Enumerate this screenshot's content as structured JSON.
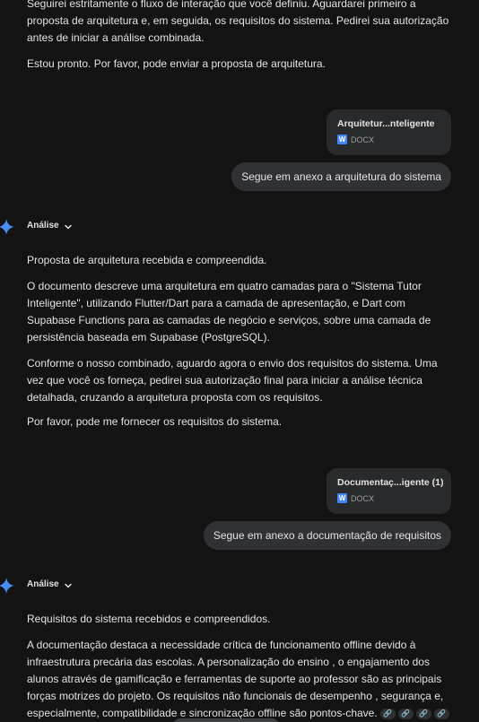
{
  "conversation": {
    "ai_intro": {
      "para1": "Seguirei estritamente o fluxo de interação que você definiu. Aguardarei primeiro a proposta de arquitetura e, em seguida, os requisitos do sistema. Pedirei sua autorização antes de iniciar a análise combinada.",
      "para2": "Estou pronto. Por favor, pode enviar a proposta de arquitetura."
    },
    "user_msg1": {
      "file_name": "Arquitetur...nteligente",
      "file_type": "DOCX",
      "text": "Segue em anexo a arquitetura do sistema"
    },
    "ai_reply1": {
      "label": "Análise",
      "para1": "Proposta de arquitetura recebida e compreendida.",
      "para2": "O documento descreve uma arquitetura em quatro camadas para o \"Sistema Tutor Inteligente\", utilizando Flutter/Dart para a camada de apresentação, e Dart com Supabase Functions para as camadas de negócio e serviços, sobre uma camada de persistência baseada em Supabase (PostgreSQL).",
      "para3": "Conforme o nosso combinado, aguardo agora o envio dos requisitos do sistema. Uma vez que você os forneça, pedirei sua autorização final para iniciar a análise técnica detalhada, cruzando a arquitetura proposta com os requisitos.",
      "para4": "Por favor, pode me fornecer os requisitos do sistema."
    },
    "user_msg2": {
      "file_name": "Documentaç...igente (1)",
      "file_type": "DOCX",
      "text": "Segue em anexo a documentação de requisitos"
    },
    "ai_reply2": {
      "label": "Análise",
      "para1": "Requisitos do sistema recebidos e compreendidos.",
      "para2": "A documentação destaca a necessidade crítica de funcionamento offline devido à infraestrutura precária das escolas. A personalização do ensino , o engajamento dos alunos através de gamificação e ferramentas de suporte ao professor  são as principais forças motrizes do projeto. Os requisitos não funcionais de desempenho , segurança e, especialmente, compatibilidade e sincronização offline  são pontos-chave."
    }
  },
  "icons": {
    "sparkle": "gemini-sparkle-icon",
    "chevron": "chevron-down-icon",
    "docx": "docx-icon",
    "link": "link-icon"
  },
  "colors": {
    "background": "#131314",
    "bubble": "#303134",
    "file_card": "#282a2c",
    "docx_blue": "#4285f4"
  }
}
